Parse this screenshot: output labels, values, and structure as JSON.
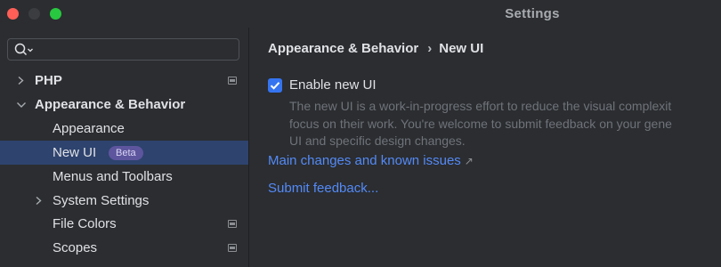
{
  "window": {
    "title": "Settings"
  },
  "search": {
    "placeholder": ""
  },
  "sidebar": {
    "items": [
      {
        "label": "PHP"
      },
      {
        "label": "Appearance & Behavior"
      },
      {
        "label": "Appearance"
      },
      {
        "label": "New UI",
        "badge": "Beta"
      },
      {
        "label": "Menus and Toolbars"
      },
      {
        "label": "System Settings"
      },
      {
        "label": "File Colors"
      },
      {
        "label": "Scopes"
      }
    ]
  },
  "content": {
    "breadcrumb": {
      "parent": "Appearance & Behavior",
      "separator": "›",
      "current": "New UI"
    },
    "enable_checkbox": {
      "label": "Enable new UI",
      "checked": true
    },
    "description_lines": [
      "The new UI is a work-in-progress effort to reduce the visual complexit",
      "focus on their work. You're welcome to submit feedback on your gene",
      "UI and specific design changes."
    ],
    "links": {
      "main_changes": "Main changes and known issues",
      "external_glyph": "↗",
      "submit_feedback": "Submit feedback..."
    }
  },
  "colors": {
    "accent": "#3574f0",
    "link": "#548af7",
    "selection": "#2e436e",
    "badge": "#5d559d"
  }
}
